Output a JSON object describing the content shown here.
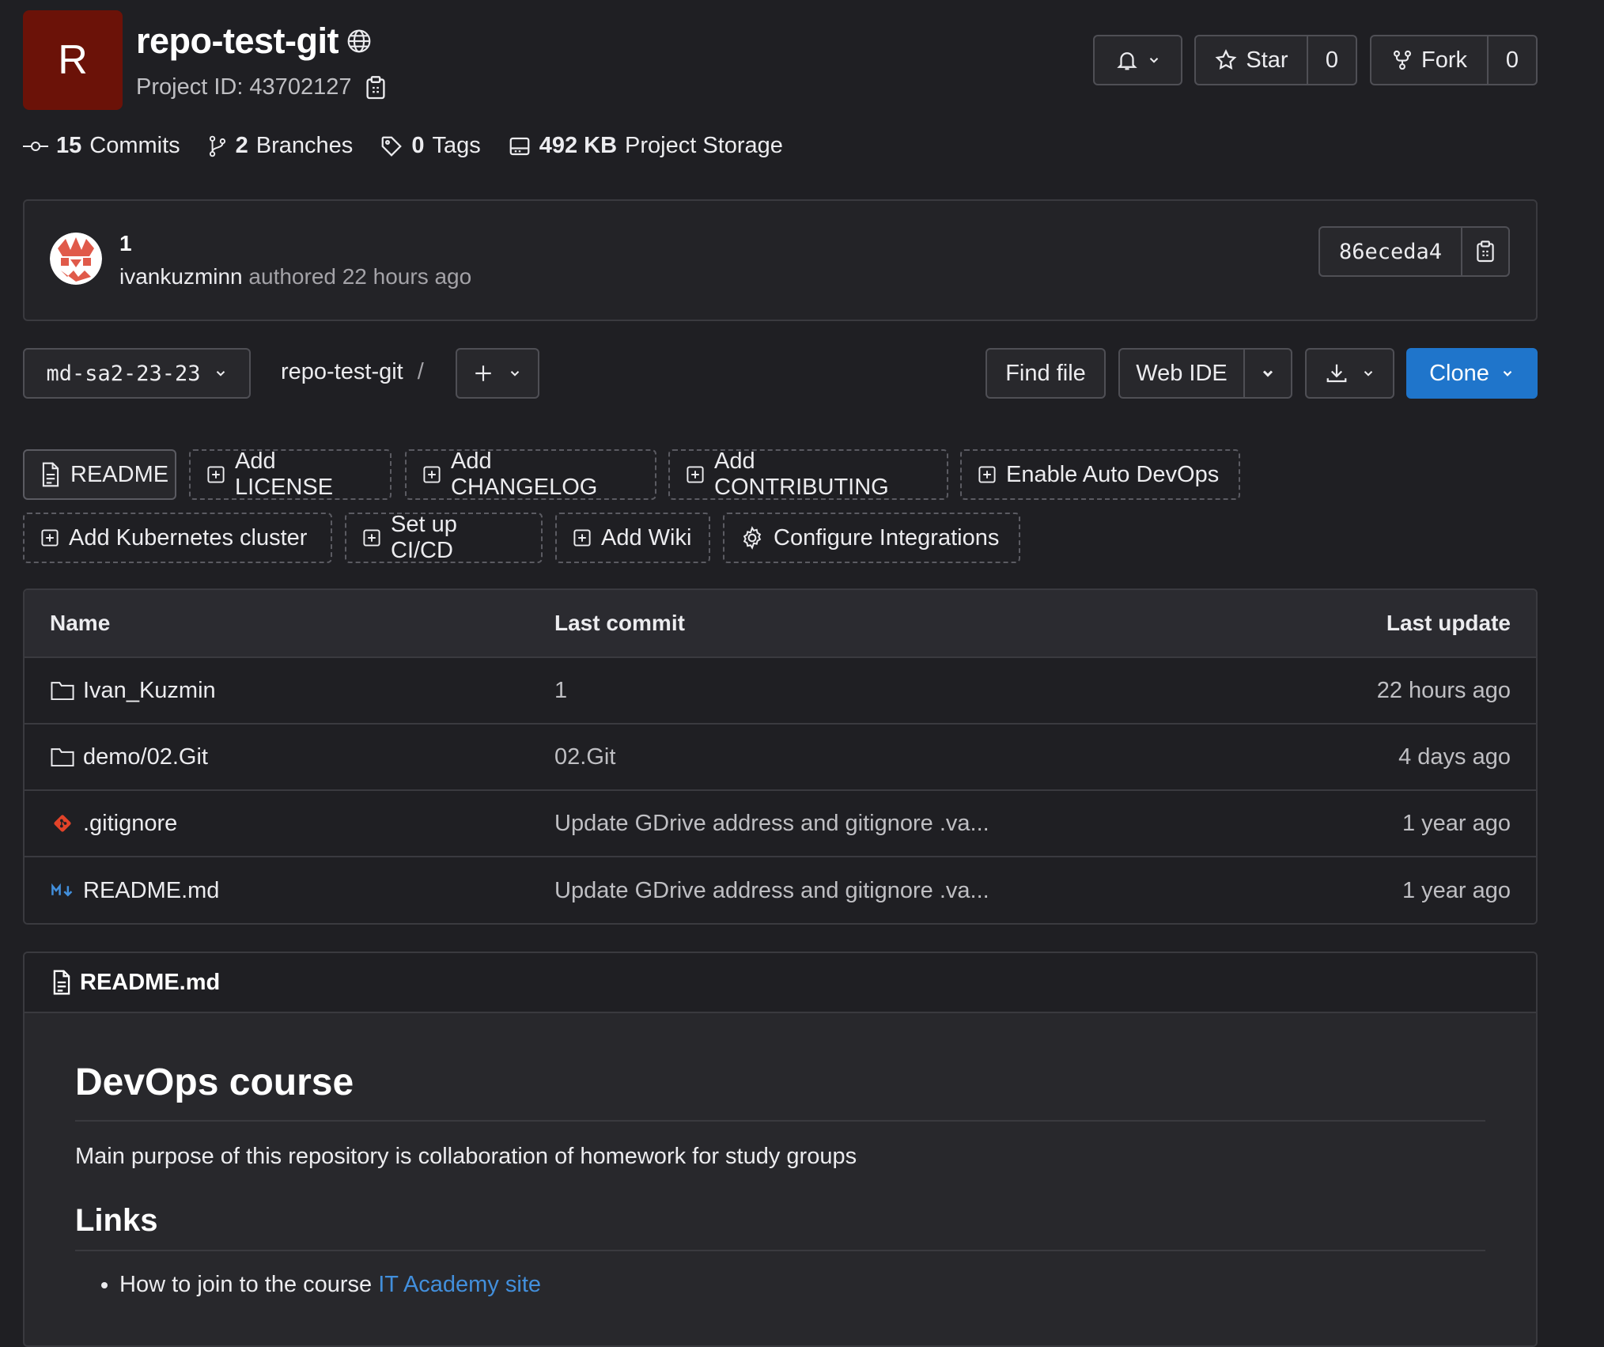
{
  "project": {
    "avatar_letter": "R",
    "name": "repo-test-git",
    "id_label": "Project ID: 43702127"
  },
  "header_actions": {
    "star_label": "Star",
    "star_count": "0",
    "fork_label": "Fork",
    "fork_count": "0"
  },
  "stats": {
    "commits_count": "15",
    "commits_label": "Commits",
    "branches_count": "2",
    "branches_label": "Branches",
    "tags_count": "0",
    "tags_label": "Tags",
    "storage_size": "492 KB",
    "storage_label": "Project Storage"
  },
  "last_commit": {
    "message": "1",
    "author": "ivankuzminn",
    "meta": "authored 22 hours ago",
    "sha": "86eceda4"
  },
  "toolbar": {
    "branch": "md-sa2-23-23",
    "breadcrumb": "repo-test-git",
    "breadcrumb_sep": "/",
    "find_file": "Find file",
    "web_ide": "Web IDE",
    "clone": "Clone"
  },
  "shortcuts": {
    "readme": "README",
    "license": "Add LICENSE",
    "changelog": "Add CHANGELOG",
    "contributing": "Add CONTRIBUTING",
    "auto_devops": "Enable Auto DevOps",
    "kubernetes": "Add Kubernetes cluster",
    "cicd": "Set up CI/CD",
    "wiki": "Add Wiki",
    "integrations": "Configure Integrations"
  },
  "file_table": {
    "headers": {
      "name": "Name",
      "last_commit": "Last commit",
      "last_update": "Last update"
    },
    "rows": [
      {
        "name": "Ivan_Kuzmin",
        "icon": "folder-icon",
        "commit": "1",
        "updated": "22 hours ago"
      },
      {
        "name": "demo/02.Git",
        "icon": "folder-icon",
        "commit": "02.Git",
        "updated": "4 days ago"
      },
      {
        "name": ".gitignore",
        "icon": "git-icon",
        "commit": "Update GDrive address and gitignore .va...",
        "updated": "1 year ago"
      },
      {
        "name": "README.md",
        "icon": "markdown-icon",
        "commit": "Update GDrive address and gitignore .va...",
        "updated": "1 year ago"
      }
    ]
  },
  "readme": {
    "filename": "README.md",
    "h1": "DevOps course",
    "intro": "Main purpose of this repository is collaboration of homework for study groups",
    "h2": "Links",
    "link_item_text": "How to join to the course ",
    "link_item_link": "IT Academy site"
  },
  "colors": {
    "background": "#1f1f23",
    "accent_blue": "#1f75cb",
    "project_avatar": "#6b1208",
    "link": "#428fdc",
    "git_orange": "#e24329"
  }
}
